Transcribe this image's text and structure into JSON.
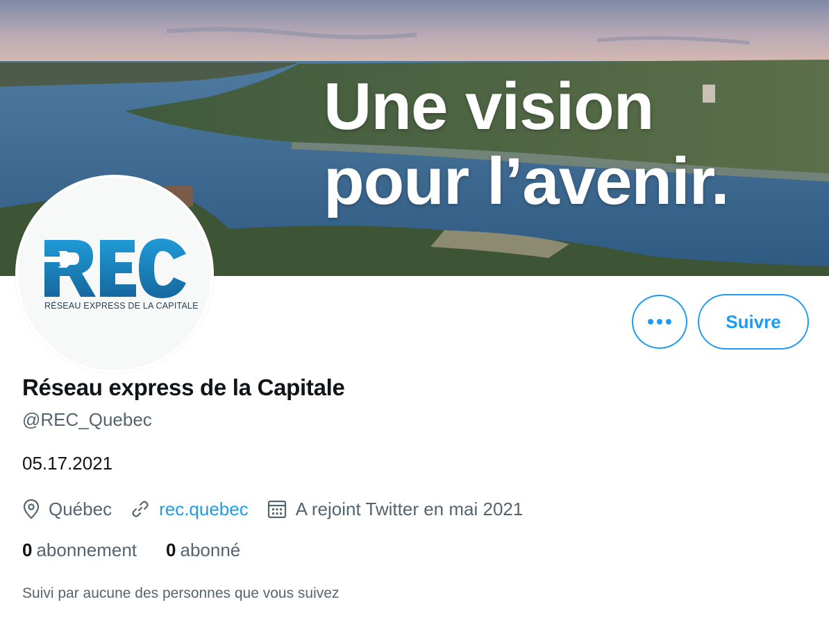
{
  "banner": {
    "headline_line1": "Une vision",
    "headline_line2": "pour l’avenir."
  },
  "avatar": {
    "logo_text": "REC",
    "tagline": "RÉSEAU EXPRESS DE LA CAPITALE",
    "brand_color": "#1b7fb8"
  },
  "actions": {
    "more_icon": "more-horizontal-icon",
    "follow_label": "Suivre"
  },
  "profile": {
    "display_name": "Réseau express de la Capitale",
    "handle": "@REC_Quebec",
    "bio": "05.17.2021",
    "location": "Québec",
    "website": "rec.quebec",
    "joined": "A rejoint Twitter en mai 2021"
  },
  "counts": {
    "following_count": "0",
    "following_label": "abonnement",
    "followers_count": "0",
    "followers_label": "abonné"
  },
  "followed_by": "Suivi par aucune des personnes que vous suivez",
  "colors": {
    "accent": "#1d9bf0",
    "text_primary": "#0f1419",
    "text_secondary": "#536471"
  }
}
